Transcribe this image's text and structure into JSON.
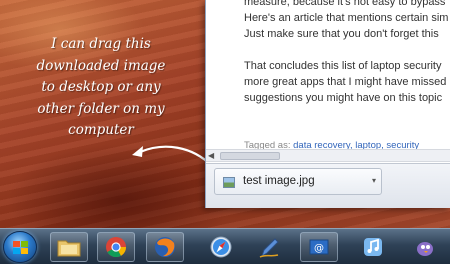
{
  "annotation": {
    "lines": [
      "I can drag this",
      "downloaded image",
      "to desktop or any",
      "other folder on my",
      "computer"
    ]
  },
  "article": {
    "paragraph1": [
      "measure, because it's not easy to bypass",
      "Here's an article that mentions certain sim",
      "Just make sure that you don't forget this"
    ],
    "paragraph2": [
      "That concludes this list of laptop security",
      "more great apps that I might have missed",
      "suggestions you might have on this topic"
    ],
    "tagged_prefix": "Tagged as:",
    "tags_text": "data recovery, laptop, security"
  },
  "download": {
    "filename": "test image.jpg"
  },
  "taskbar": {
    "apps": [
      "start-button",
      "windows-explorer",
      "google-chrome",
      "firefox",
      "safari",
      "pen-tool",
      "outlook-mail",
      "music-player",
      "app-bird"
    ]
  }
}
